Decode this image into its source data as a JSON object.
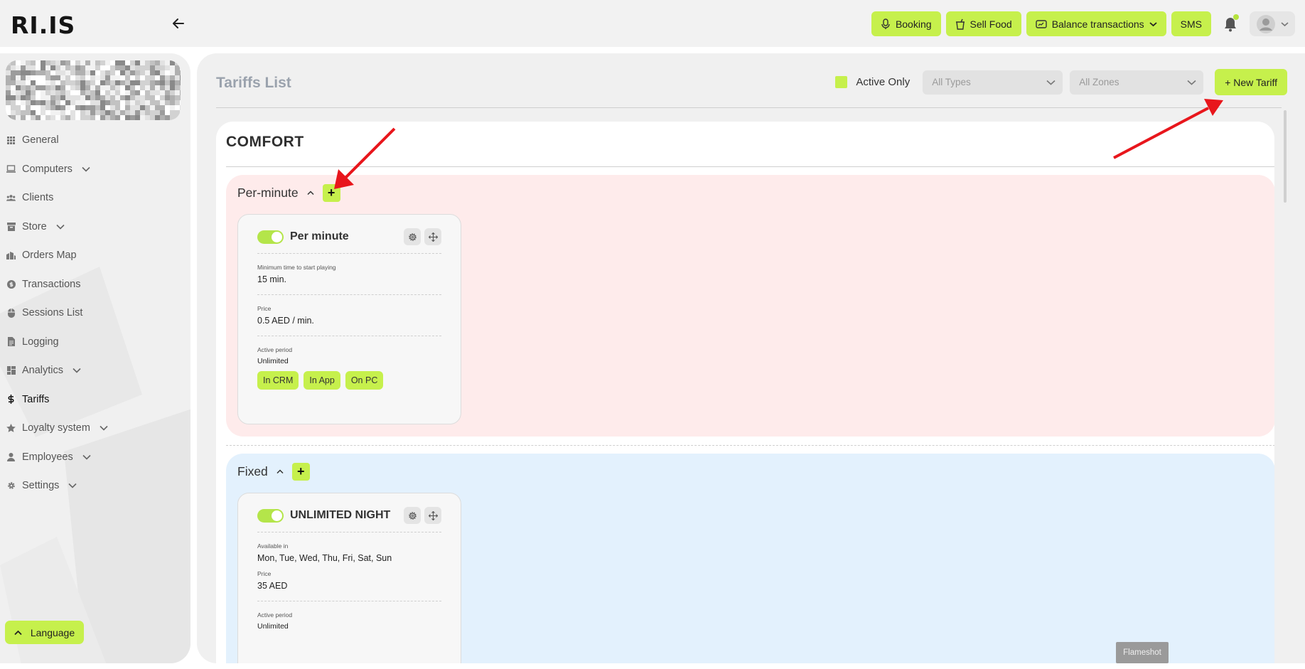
{
  "app": {
    "logo_text": "RI.IS"
  },
  "topbar": {
    "booking_label": "Booking",
    "sell_food_label": "Sell Food",
    "balance_label": "Balance transactions",
    "sms_label": "SMS"
  },
  "sidebar": {
    "items": [
      {
        "label": "General",
        "icon": "grid-icon",
        "has_chevron": false
      },
      {
        "label": "Computers",
        "icon": "laptop-icon",
        "has_chevron": true
      },
      {
        "label": "Clients",
        "icon": "users-icon",
        "has_chevron": false
      },
      {
        "label": "Store",
        "icon": "box-icon",
        "has_chevron": true
      },
      {
        "label": "Orders Map",
        "icon": "building-icon",
        "has_chevron": false
      },
      {
        "label": "Transactions",
        "icon": "coin-icon",
        "has_chevron": false
      },
      {
        "label": "Sessions List",
        "icon": "mouse-icon",
        "has_chevron": false
      },
      {
        "label": "Logging",
        "icon": "file-icon",
        "has_chevron": false
      },
      {
        "label": "Analytics",
        "icon": "dashboard-icon",
        "has_chevron": true
      },
      {
        "label": "Tariffs",
        "icon": "dollar-icon",
        "has_chevron": false,
        "active": true
      },
      {
        "label": "Loyalty system",
        "icon": "star-icon",
        "has_chevron": true
      },
      {
        "label": "Employees",
        "icon": "person-icon",
        "has_chevron": true
      },
      {
        "label": "Settings",
        "icon": "gear-icon",
        "has_chevron": true
      }
    ],
    "language_label": "Language"
  },
  "main": {
    "title": "Tariffs List",
    "active_only_label": "Active Only",
    "types_placeholder": "All Types",
    "zones_placeholder": "All Zones",
    "new_tariff_label": "+ New Tariff",
    "zone_name": "COMFORT",
    "groups": [
      {
        "name": "Per-minute",
        "color": "#feebeb",
        "card": {
          "name": "Per minute",
          "rows": [
            {
              "label": "Minimum time to start playing",
              "value": "15 min."
            },
            {
              "label": "Price",
              "value": "0.5 AED / min."
            },
            {
              "label": "Active period",
              "value": "Unlimited"
            }
          ],
          "tags": [
            "In CRM",
            "In App",
            "On PC"
          ]
        }
      },
      {
        "name": "Fixed",
        "color": "#e3f1fd",
        "card": {
          "name": "UNLIMITED NIGHT",
          "rows": [
            {
              "label": "Available in",
              "value": "Mon, Tue, Wed, Thu, Fri, Sat, Sun"
            },
            {
              "label": "Price",
              "value": "35 AED"
            },
            {
              "label": "Active period",
              "value": "Unlimited"
            }
          ]
        }
      }
    ]
  },
  "overlay": {
    "flameshot_label": "Flameshot"
  },
  "colors": {
    "accent": "#c6f04c",
    "annotation_arrow": "#e8161c"
  }
}
